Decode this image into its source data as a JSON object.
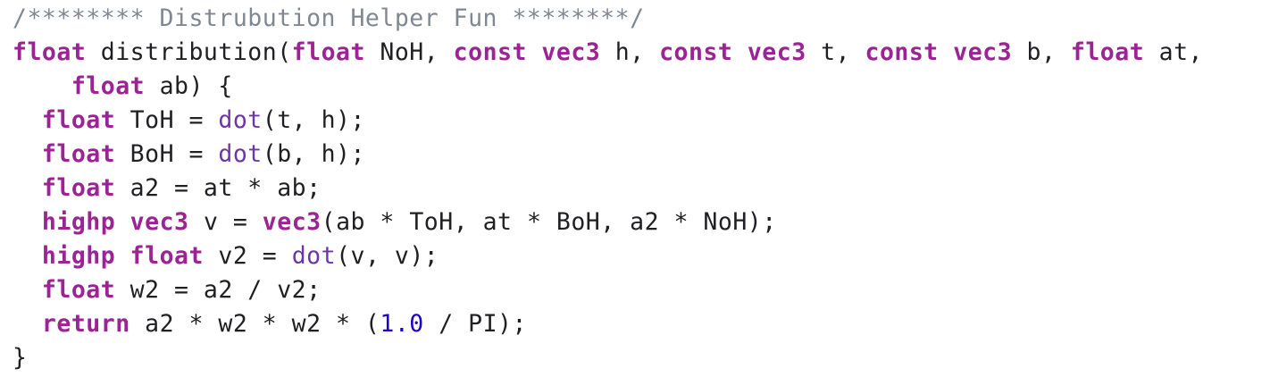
{
  "editor": {
    "colors": {
      "background": "#ffffff",
      "plain": "#1f1f24",
      "keyword": "#9b2393",
      "function": "#6c36a9",
      "number": "#1c00cf",
      "comment": "#7f8892"
    },
    "lines": [
      [
        {
          "t": "/******** Distrubution Helper Fun ********/",
          "c": "comment"
        }
      ],
      [
        {
          "t": "float",
          "c": "keyword"
        },
        {
          "t": " distribution(",
          "c": "plain"
        },
        {
          "t": "float",
          "c": "keyword"
        },
        {
          "t": " NoH, ",
          "c": "plain"
        },
        {
          "t": "const",
          "c": "keyword"
        },
        {
          "t": " ",
          "c": "plain"
        },
        {
          "t": "vec3",
          "c": "keyword"
        },
        {
          "t": " h, ",
          "c": "plain"
        },
        {
          "t": "const",
          "c": "keyword"
        },
        {
          "t": " ",
          "c": "plain"
        },
        {
          "t": "vec3",
          "c": "keyword"
        },
        {
          "t": " t, ",
          "c": "plain"
        },
        {
          "t": "const",
          "c": "keyword"
        },
        {
          "t": " ",
          "c": "plain"
        },
        {
          "t": "vec3",
          "c": "keyword"
        },
        {
          "t": " b, ",
          "c": "plain"
        },
        {
          "t": "float",
          "c": "keyword"
        },
        {
          "t": " at,",
          "c": "plain"
        }
      ],
      [
        {
          "t": "    ",
          "c": "plain"
        },
        {
          "t": "float",
          "c": "keyword"
        },
        {
          "t": " ab) {",
          "c": "plain"
        }
      ],
      [
        {
          "t": "  ",
          "c": "plain"
        },
        {
          "t": "float",
          "c": "keyword"
        },
        {
          "t": " ToH = ",
          "c": "plain"
        },
        {
          "t": "dot",
          "c": "func"
        },
        {
          "t": "(t, h);",
          "c": "plain"
        }
      ],
      [
        {
          "t": "  ",
          "c": "plain"
        },
        {
          "t": "float",
          "c": "keyword"
        },
        {
          "t": " BoH = ",
          "c": "plain"
        },
        {
          "t": "dot",
          "c": "func"
        },
        {
          "t": "(b, h);",
          "c": "plain"
        }
      ],
      [
        {
          "t": "  ",
          "c": "plain"
        },
        {
          "t": "float",
          "c": "keyword"
        },
        {
          "t": " a2 = at * ab;",
          "c": "plain"
        }
      ],
      [
        {
          "t": "  ",
          "c": "plain"
        },
        {
          "t": "highp",
          "c": "keyword"
        },
        {
          "t": " ",
          "c": "plain"
        },
        {
          "t": "vec3",
          "c": "keyword"
        },
        {
          "t": " v = ",
          "c": "plain"
        },
        {
          "t": "vec3",
          "c": "keyword"
        },
        {
          "t": "(ab * ToH, at * BoH, a2 * NoH);",
          "c": "plain"
        }
      ],
      [
        {
          "t": "  ",
          "c": "plain"
        },
        {
          "t": "highp",
          "c": "keyword"
        },
        {
          "t": " ",
          "c": "plain"
        },
        {
          "t": "float",
          "c": "keyword"
        },
        {
          "t": " v2 = ",
          "c": "plain"
        },
        {
          "t": "dot",
          "c": "func"
        },
        {
          "t": "(v, v);",
          "c": "plain"
        }
      ],
      [
        {
          "t": "  ",
          "c": "plain"
        },
        {
          "t": "float",
          "c": "keyword"
        },
        {
          "t": " w2 = a2 / v2;",
          "c": "plain"
        }
      ],
      [
        {
          "t": "  ",
          "c": "plain"
        },
        {
          "t": "return",
          "c": "keyword"
        },
        {
          "t": " a2 * w2 * w2 * (",
          "c": "plain"
        },
        {
          "t": "1.0",
          "c": "number"
        },
        {
          "t": " / PI);",
          "c": "plain"
        }
      ],
      [
        {
          "t": "}",
          "c": "plain"
        }
      ]
    ]
  }
}
